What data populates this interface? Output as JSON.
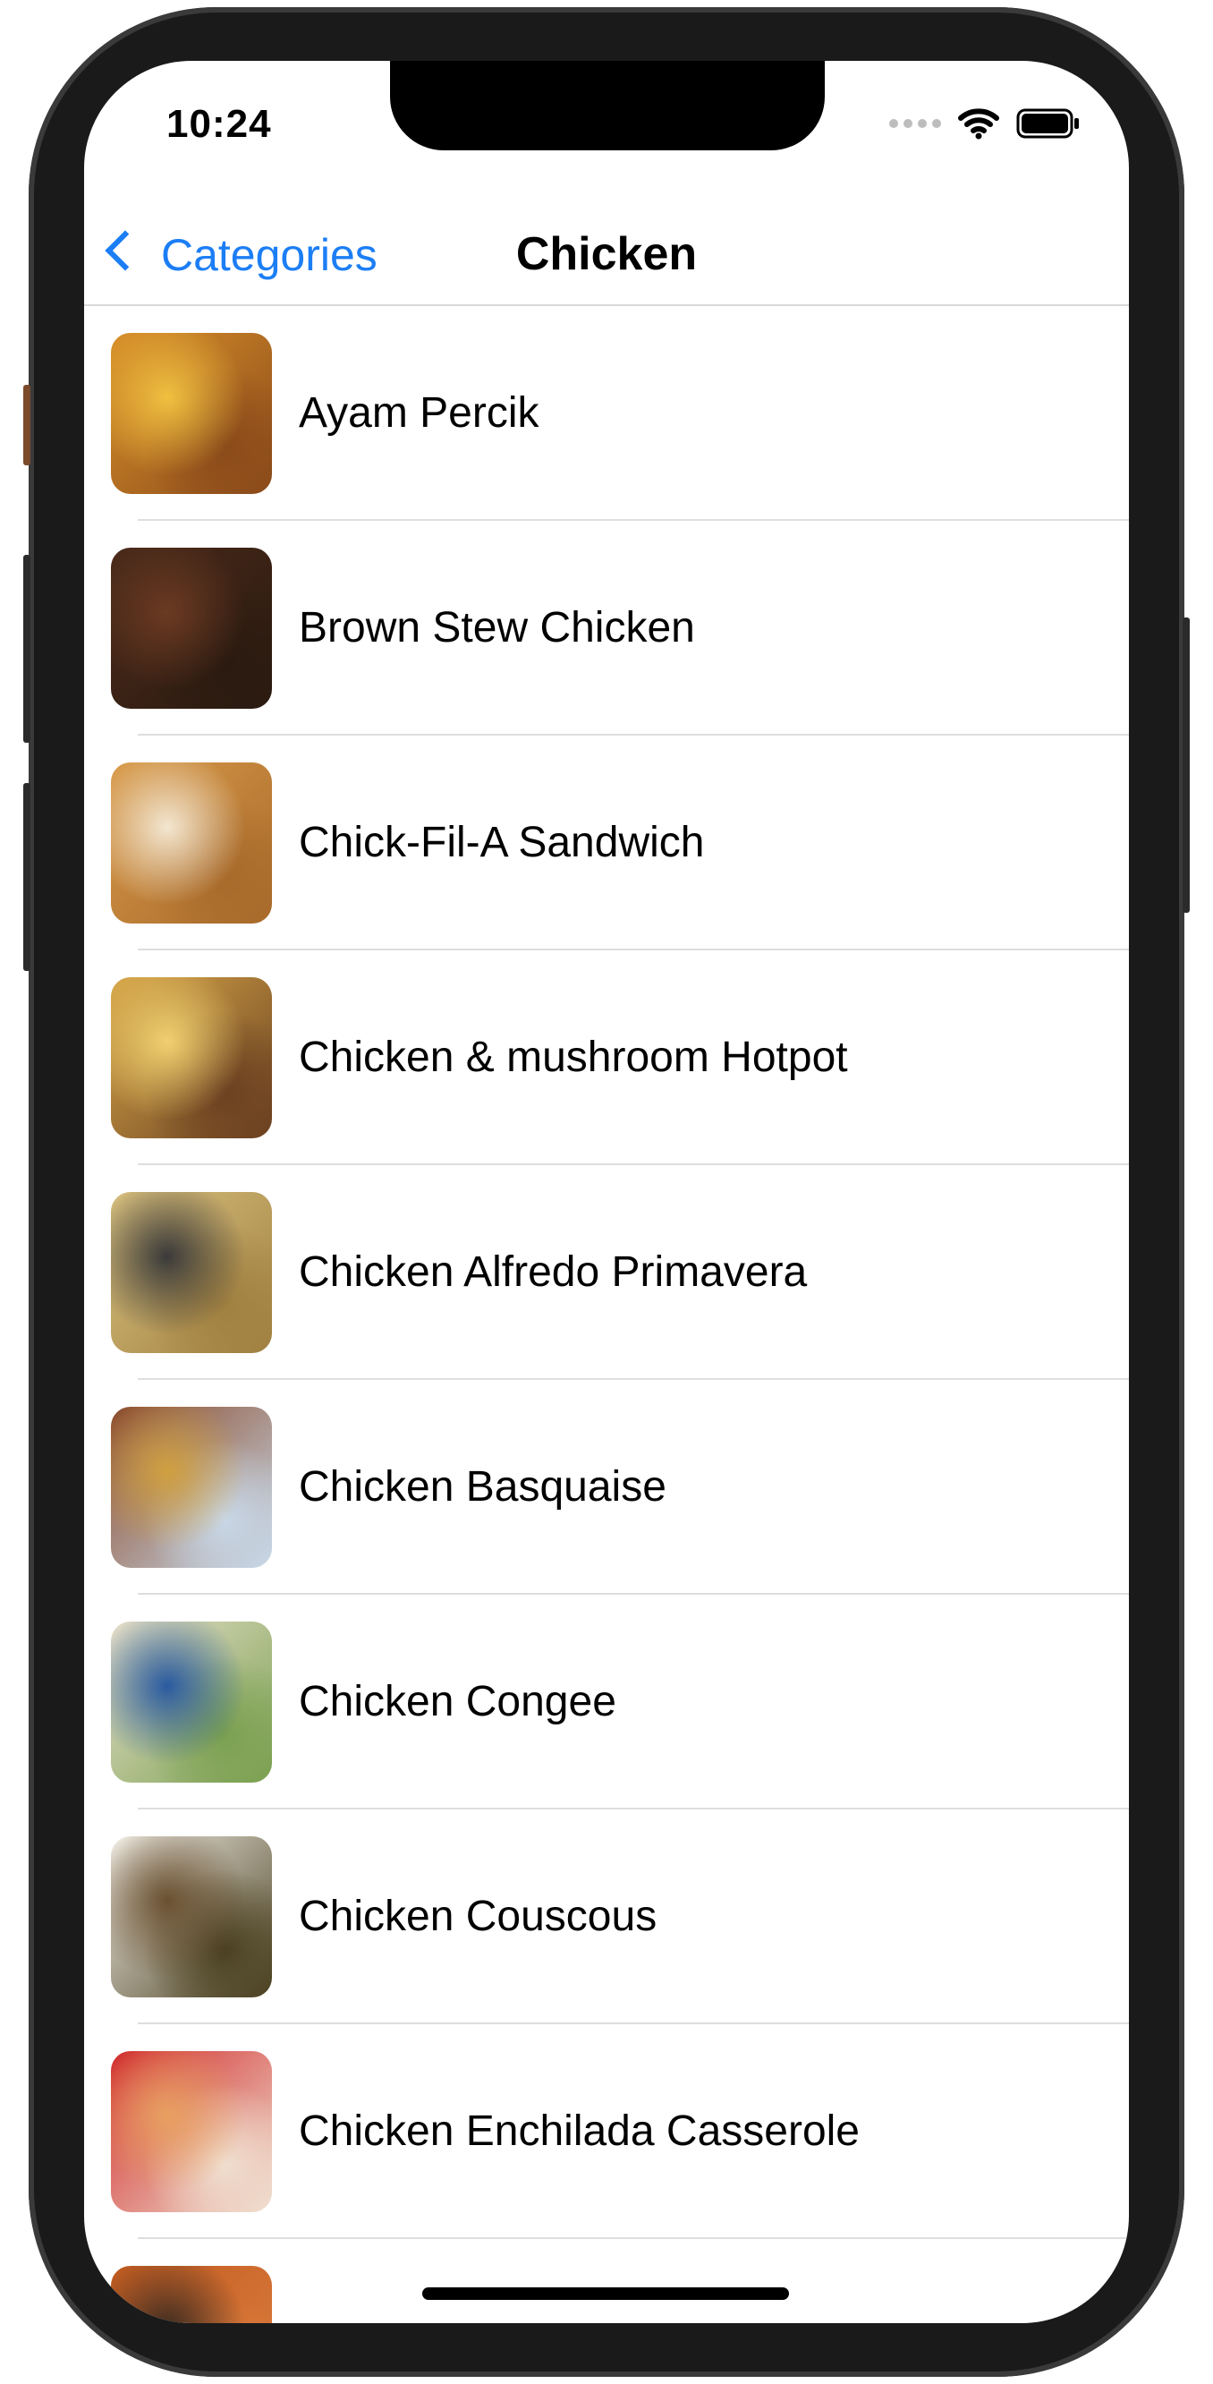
{
  "status_bar": {
    "time": "10:24"
  },
  "nav": {
    "back_label": "Categories",
    "title": "Chicken"
  },
  "recipes": [
    {
      "name": "Ayam Percik",
      "colors": [
        "#d9902a",
        "#f0c040",
        "#8a4a1a"
      ]
    },
    {
      "name": "Brown Stew Chicken",
      "colors": [
        "#4a2a1a",
        "#6b3a22",
        "#2a1a10"
      ]
    },
    {
      "name": "Chick-Fil-A Sandwich",
      "colors": [
        "#d89a4a",
        "#f3e6d0",
        "#a86a2a"
      ]
    },
    {
      "name": "Chicken & mushroom Hotpot",
      "colors": [
        "#d8a84a",
        "#f0d070",
        "#6a4020"
      ]
    },
    {
      "name": "Chicken Alfredo Primavera",
      "colors": [
        "#d8c080",
        "#3a3a3a",
        "#a08040"
      ]
    },
    {
      "name": "Chicken Basquaise",
      "colors": [
        "#8a4a2a",
        "#d0a040",
        "#c8d8e8"
      ]
    },
    {
      "name": "Chicken Congee",
      "colors": [
        "#e8e0cc",
        "#2a5aa0",
        "#7aa050"
      ]
    },
    {
      "name": "Chicken Couscous",
      "colors": [
        "#f4f0e8",
        "#6a5030",
        "#4a4020"
      ]
    },
    {
      "name": "Chicken Enchilada Casserole",
      "colors": [
        "#d02a2a",
        "#e8a060",
        "#f0e0d0"
      ]
    },
    {
      "name": "",
      "colors": [
        "#c05a20",
        "#3a2a20",
        "#e08040"
      ]
    }
  ]
}
